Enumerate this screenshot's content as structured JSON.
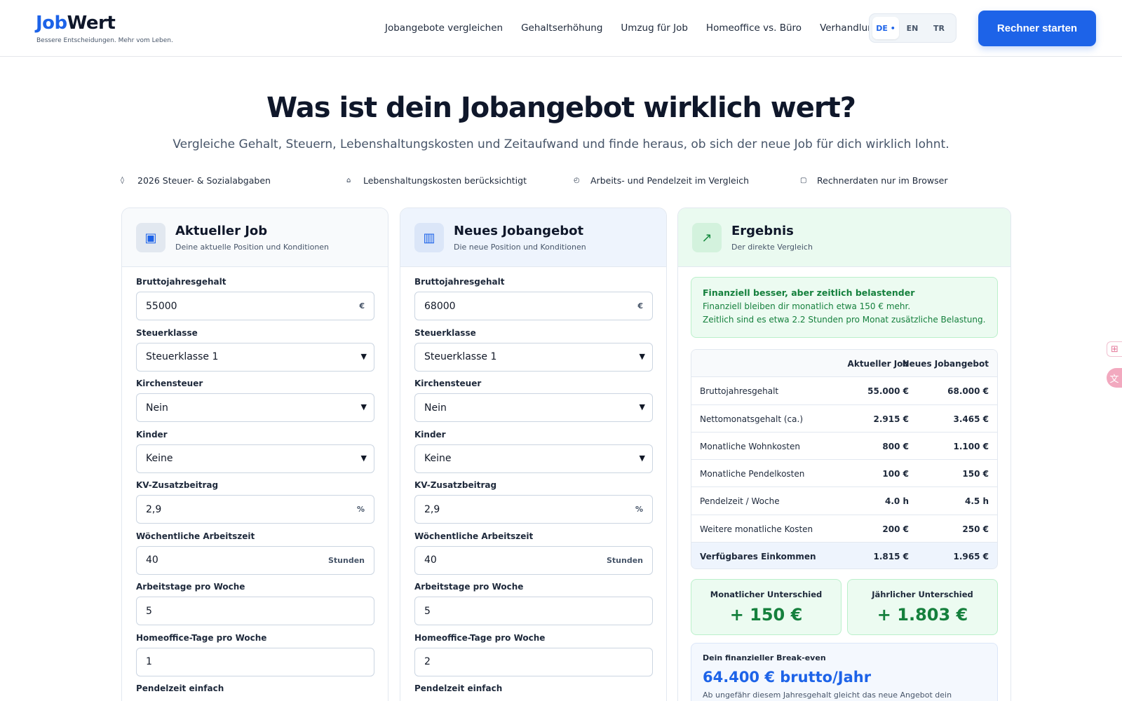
{
  "brand": {
    "logo_part1": "Job",
    "logo_part2": "Wert",
    "tagline": "Bessere Entscheidungen. Mehr vom Leben."
  },
  "nav": {
    "items": [
      "Jobangebote vergleichen",
      "Gehaltserhöhung",
      "Umzug für Job",
      "Homeoffice vs. Büro",
      "Verhandlung"
    ]
  },
  "lang": {
    "options": [
      "DE •",
      "EN",
      "TR"
    ],
    "active": "DE"
  },
  "cta": {
    "label": "Rechner starten"
  },
  "hero": {
    "title": "Was ist dein Jobangebot wirklich wert?",
    "subtitle": "Vergleiche Gehalt, Steuern, Lebenshaltungskosten und Zeitaufwand und finde heraus, ob sich der neue Job für dich wirklich lohnt."
  },
  "features": [
    {
      "icon": "diamond-icon",
      "glyph": "◊",
      "label": "2026 Steuer- & Sozialabgaben"
    },
    {
      "icon": "home-icon",
      "glyph": "⌂",
      "label": "Lebenshaltungskosten berücksichtigt"
    },
    {
      "icon": "clock-icon",
      "glyph": "◴",
      "label": "Arbeits- und Pendelzeit im Vergleich"
    },
    {
      "icon": "lock-icon",
      "glyph": "▢",
      "label": "Rechnerdaten nur im Browser"
    }
  ],
  "labels": {
    "gross": "Bruttojahresgehalt",
    "tax_class": "Steuerklasse",
    "church": "Kirchensteuer",
    "kids": "Kinder",
    "kv": "KV-Zusatzbeitrag",
    "hours": "Wöchentliche Arbeitszeit",
    "days": "Arbeitstage pro Woche",
    "homeoffice": "Homeoffice-Tage pro Woche",
    "commute": "Pendelzeit einfach",
    "euro": "€",
    "percent": "%",
    "hours_unit": "Stunden"
  },
  "current": {
    "title": "Aktueller Job",
    "subtitle": "Deine aktuelle Position und Konditionen",
    "gross": "55000",
    "tax_class": "Steuerklasse 1",
    "church": "Nein",
    "kids": "Keine",
    "kv": "2,9",
    "hours": "40",
    "days": "5",
    "homeoffice": "1"
  },
  "offer": {
    "title": "Neues Jobangebot",
    "subtitle": "Die neue Position und Konditionen",
    "gross": "68000",
    "tax_class": "Steuerklasse 1",
    "church": "Nein",
    "kids": "Keine",
    "kv": "2,9",
    "hours": "40",
    "days": "5",
    "homeoffice": "2"
  },
  "result": {
    "title": "Ergebnis",
    "subtitle": "Der direkte Vergleich",
    "verdict_title": "Finanziell besser, aber zeitlich belastender",
    "verdict_line1": "Finanziell bleiben dir monatlich etwa 150 € mehr.",
    "verdict_line2": "Zeitlich sind es etwa 2.2 Stunden pro Monat zusätzliche Belastung.",
    "col1": "Aktueller Job",
    "col2": "Neues Jobangebot",
    "rows": [
      {
        "label": "Bruttojahresgehalt",
        "a": "55.000 €",
        "b": "68.000 €"
      },
      {
        "label": "Nettomonatsgehalt (ca.)",
        "a": "2.915 €",
        "b": "3.465 €"
      },
      {
        "label": "Monatliche Wohnkosten",
        "a": "800 €",
        "b": "1.100 €"
      },
      {
        "label": "Monatliche Pendelkosten",
        "a": "100 €",
        "b": "150 €"
      },
      {
        "label": "Pendelzeit / Woche",
        "a": "4.0 h",
        "b": "4.5 h"
      },
      {
        "label": "Weitere monatliche Kosten",
        "a": "200 €",
        "b": "250 €"
      }
    ],
    "total": {
      "label": "Verfügbares Einkommen",
      "a": "1.815 €",
      "b": "1.965 €"
    },
    "monthly_label": "Monatlicher Unterschied",
    "monthly_value": "+ 150 €",
    "yearly_label": "Jährlicher Unterschied",
    "yearly_value": "+ 1.803 €",
    "breakeven_label": "Dein finanzieller Break-even",
    "breakeven_value": "64.400 € brutto/Jahr",
    "breakeven_desc": "Ab ungefähr diesem Jahresgehalt gleicht das neue Angebot dein aktuelles"
  },
  "colors": {
    "accent": "#1d63e8",
    "success": "#15803d",
    "success_bg": "#ecfbf1"
  }
}
